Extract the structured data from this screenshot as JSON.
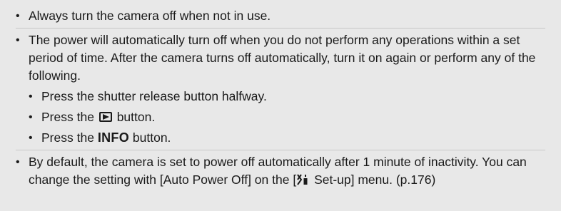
{
  "notes": {
    "item1": "Always turn the camera off when not in use.",
    "item2": "The power will automatically turn off when you do not perform any operations within a set period of time. After the camera turns off automatically, turn it on again or perform any of the following.",
    "sub1": "Press the shutter release button halfway.",
    "sub2_prefix": "Press the",
    "sub2_suffix": "button.",
    "sub3_prefix": "Press the",
    "sub3_key": "INFO",
    "sub3_suffix": "button.",
    "item3_part1": "By default, the camera is set to power off automatically after 1 minute of inactivity. You can change the setting with [Auto Power Off] on the [",
    "item3_part2": "Set-up] menu. (p.176)"
  },
  "bullet_char": "•",
  "icons": {
    "playback": "playback-button-icon",
    "setup": "setup-menu-icon"
  },
  "colors": {
    "background": "#e8e8e8",
    "text": "#1a1a1a"
  }
}
